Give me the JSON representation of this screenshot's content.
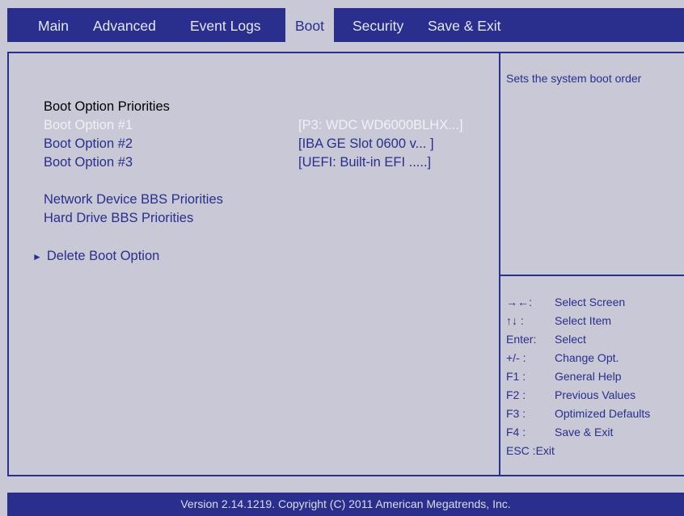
{
  "tabs": [
    {
      "label": "Main"
    },
    {
      "label": "Advanced"
    },
    {
      "label": "Event Logs"
    },
    {
      "label": "Boot"
    },
    {
      "label": "Security"
    },
    {
      "label": "Save & Exit"
    }
  ],
  "active_tab": "Boot",
  "boot": {
    "heading": "Boot Option Priorities",
    "options": [
      {
        "label": "Boot Option #1",
        "value": "[P3: WDC WD6000BLHX...]"
      },
      {
        "label": "Boot Option #2",
        "value": "[IBA GE Slot 0600 v... ]"
      },
      {
        "label": "Boot Option #3",
        "value": "[UEFI: Built-in EFI .....]"
      }
    ],
    "network_bbs": "Network Device BBS Priorities",
    "hdd_bbs": "Hard Drive BBS Priorities",
    "delete_option": "Delete Boot Option",
    "delete_arrow": "►"
  },
  "help_text": "Sets the system boot order",
  "keys": [
    {
      "key": "→←:",
      "desc": "Select Screen"
    },
    {
      "key": "↑↓ :",
      "desc": "Select Item"
    },
    {
      "key": "Enter:",
      "desc": "Select"
    },
    {
      "key": "+/- :",
      "desc": "Change Opt."
    },
    {
      "key": "F1 :",
      "desc": "General Help"
    },
    {
      "key": "F2 :",
      "desc": "Previous Values"
    },
    {
      "key": "F3 :",
      "desc": "Optimized Defaults"
    },
    {
      "key": "F4 :",
      "desc": "Save & Exit"
    },
    {
      "key": "ESC :Exit",
      "desc": ""
    }
  ],
  "footer": "Version 2.14.1219. Copyright (C) 2011 American Megatrends, Inc.",
  "colors": {
    "accent": "#2a2e8c",
    "background": "#c8c8d6",
    "selected_text": "#f0f0f6"
  }
}
